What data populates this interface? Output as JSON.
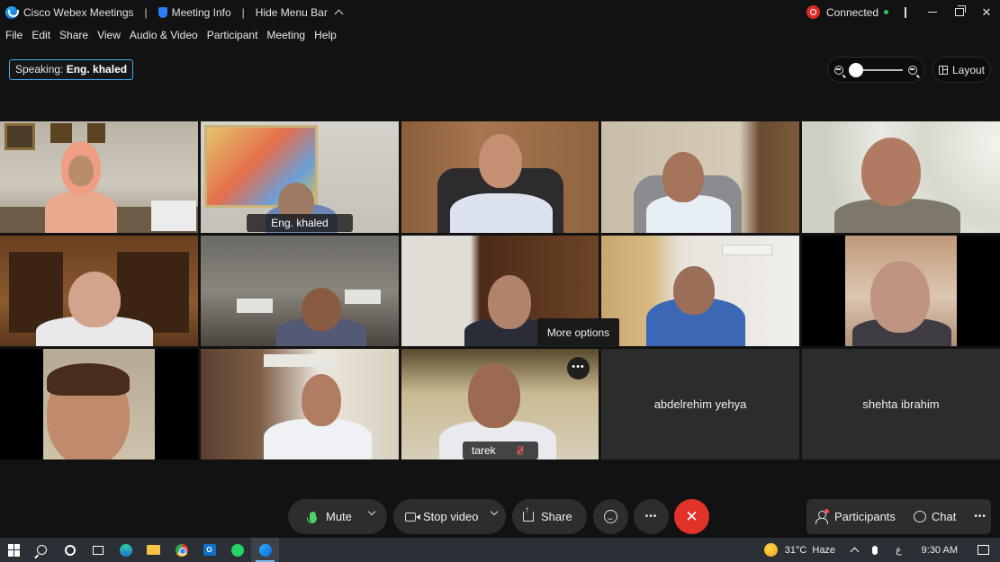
{
  "titlebar": {
    "app_name": "Cisco Webex Meetings",
    "meeting_info": "Meeting Info",
    "hide_menu": "Hide Menu Bar",
    "status": "Connected"
  },
  "menu": [
    "File",
    "Edit",
    "Share",
    "View",
    "Audio & Video",
    "Participant",
    "Meeting",
    "Help"
  ],
  "speaking": {
    "label": "Speaking:",
    "name": "Eng. khaled"
  },
  "layout_label": "Layout",
  "zoom_level": 0.0,
  "tiles": {
    "active_name": "Eng. khaled",
    "tarek": "tarek",
    "abdelrehim": "abdelrehim yehya",
    "shehta": "shehta ibrahim"
  },
  "tooltip": "More options",
  "more_dots": "•••",
  "controls": {
    "mute": "Mute",
    "stop_video": "Stop video",
    "share": "Share",
    "participants": "Participants",
    "chat": "Chat",
    "more": "•••",
    "end": "✕"
  },
  "taskbar": {
    "weather_temp": "31°C",
    "weather_desc": "Haze",
    "lang": "ع",
    "time": "9:30 AM",
    "outlook_letter": "O"
  },
  "colors": {
    "accent_blue": "#2ba6e8",
    "end_red": "#e2332b",
    "mic_green": "#4fd36a",
    "connected_green": "#35c15a"
  }
}
